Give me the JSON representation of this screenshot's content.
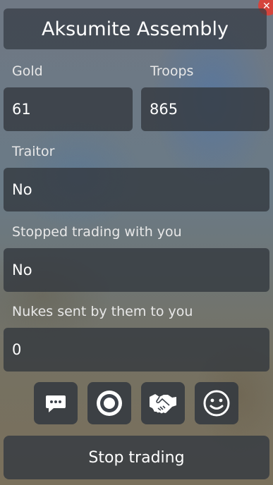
{
  "title": "Aksumite Assembly",
  "stats": {
    "gold_label": "Gold",
    "gold_value": "61",
    "troops_label": "Troops",
    "troops_value": "865"
  },
  "traitor": {
    "label": "Traitor",
    "value": "No"
  },
  "stopped_trading": {
    "label": "Stopped trading with you",
    "value": "No"
  },
  "nukes": {
    "label": "Nukes sent by them to you",
    "value": "0"
  },
  "actions": [
    {
      "icon": "chat-icon"
    },
    {
      "icon": "target-icon"
    },
    {
      "icon": "handshake-icon"
    },
    {
      "icon": "emoji-icon"
    }
  ],
  "stop_trading_label": "Stop trading",
  "colors": {
    "panel": "#343a42",
    "text": "#ffffff",
    "close": "#d5443c"
  }
}
